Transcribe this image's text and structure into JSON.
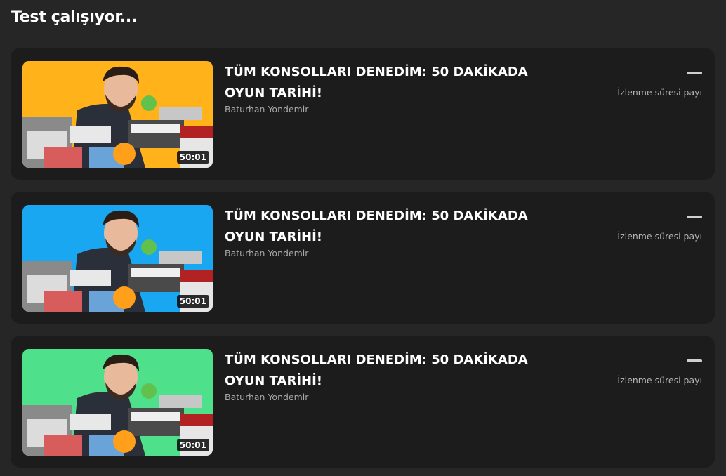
{
  "header": {
    "title": "Test çalışıyor..."
  },
  "cards": [
    {
      "title": "TÜM KONSOLLARI DENEDİM: 50 DAKİKADA OYUN TARİHİ!",
      "channel": "Baturhan Yondemir",
      "duration": "50:01",
      "metric_value": "—",
      "metric_label": "İzlenme süresi payı",
      "thumbnail_bg": "#ffb21a",
      "thumbnail_icon": "video-thumbnail"
    },
    {
      "title": "TÜM KONSOLLARI DENEDİM: 50 DAKİKADA OYUN TARİHİ!",
      "channel": "Baturhan Yondemir",
      "duration": "50:01",
      "metric_value": "—",
      "metric_label": "İzlenme süresi payı",
      "thumbnail_bg": "#1aa7f2",
      "thumbnail_icon": "video-thumbnail"
    },
    {
      "title": "TÜM KONSOLLARI DENEDİM: 50 DAKİKADA OYUN TARİHİ!",
      "channel": "Baturhan Yondemir",
      "duration": "50:01",
      "metric_value": "—",
      "metric_label": "İzlenme süresi payı",
      "thumbnail_bg": "#4fe08c",
      "thumbnail_icon": "video-thumbnail"
    }
  ],
  "colors": {
    "page_background": "#262626",
    "card_background": "#1c1c1c",
    "secondary_text": "#aaaaaa"
  }
}
